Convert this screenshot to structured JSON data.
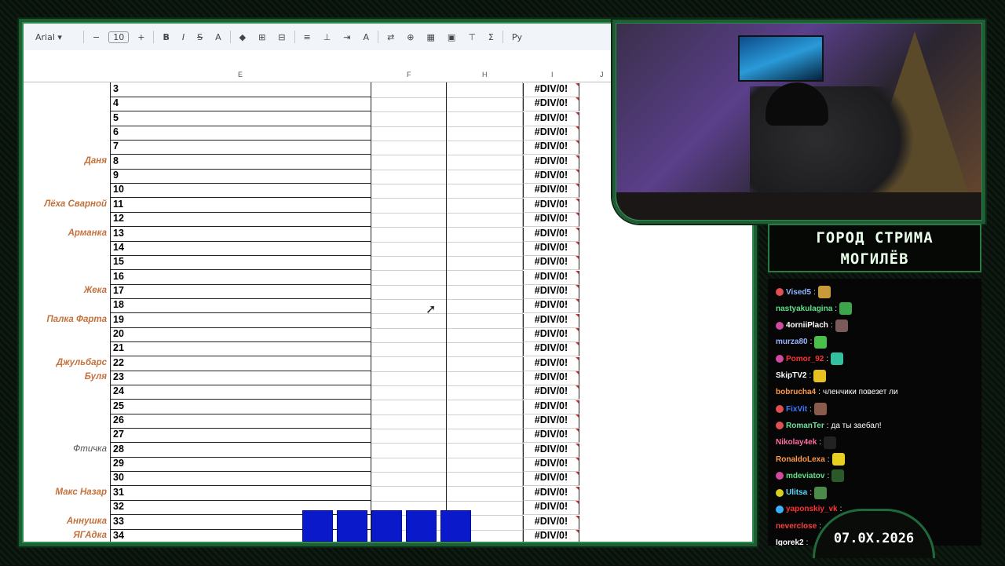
{
  "toolbar": {
    "font": "Arial",
    "font_size": "10",
    "buttons": [
      "−",
      "+",
      "B",
      "I",
      "S",
      "A",
      "◆",
      "⊞",
      "⊟",
      "≡",
      "⊥",
      "⇥",
      "A",
      "⇄",
      "⊕",
      "▦",
      "▣",
      "⊤",
      "Σ",
      "Py"
    ]
  },
  "columns": {
    "e": "E",
    "f": "F",
    "h": "H",
    "i": "I",
    "j": "J"
  },
  "rows": [
    {
      "n": "3",
      "name": "",
      "val": "#DIV/0!"
    },
    {
      "n": "4",
      "name": "",
      "val": "#DIV/0!"
    },
    {
      "n": "5",
      "name": "",
      "val": "#DIV/0!"
    },
    {
      "n": "6",
      "name": "",
      "val": "#DIV/0!"
    },
    {
      "n": "7",
      "name": "",
      "val": "#DIV/0!"
    },
    {
      "n": "8",
      "name": "Даня",
      "val": "#DIV/0!"
    },
    {
      "n": "9",
      "name": "",
      "val": "#DIV/0!"
    },
    {
      "n": "10",
      "name": "",
      "val": "#DIV/0!"
    },
    {
      "n": "11",
      "name": "Лёха Сварной",
      "val": "#DIV/0!"
    },
    {
      "n": "12",
      "name": "",
      "val": "#DIV/0!"
    },
    {
      "n": "13",
      "name": "Арманка",
      "val": "#DIV/0!"
    },
    {
      "n": "14",
      "name": "",
      "val": "#DIV/0!"
    },
    {
      "n": "15",
      "name": "",
      "val": "#DIV/0!"
    },
    {
      "n": "16",
      "name": "",
      "val": "#DIV/0!"
    },
    {
      "n": "17",
      "name": "Жека",
      "val": "#DIV/0!"
    },
    {
      "n": "18",
      "name": "",
      "val": "#DIV/0!"
    },
    {
      "n": "19",
      "name": "Палка Фарта",
      "val": "#DIV/0!"
    },
    {
      "n": "20",
      "name": "",
      "val": "#DIV/0!"
    },
    {
      "n": "21",
      "name": "",
      "val": "#DIV/0!"
    },
    {
      "n": "22",
      "name": "Джульбарс",
      "val": "#DIV/0!"
    },
    {
      "n": "23",
      "name": "Буля",
      "val": "#DIV/0!"
    },
    {
      "n": "24",
      "name": "",
      "val": "#DIV/0!"
    },
    {
      "n": "25",
      "name": "",
      "val": "#DIV/0!"
    },
    {
      "n": "26",
      "name": "",
      "val": "#DIV/0!"
    },
    {
      "n": "27",
      "name": "",
      "val": "#DIV/0!"
    },
    {
      "n": "28",
      "name": "Фтичка",
      "val": "#DIV/0!"
    },
    {
      "n": "29",
      "name": "",
      "val": "#DIV/0!"
    },
    {
      "n": "30",
      "name": "",
      "val": "#DIV/0!"
    },
    {
      "n": "31",
      "name": "Макс Назар",
      "val": "#DIV/0!"
    },
    {
      "n": "32",
      "name": "",
      "val": "#DIV/0!"
    },
    {
      "n": "33",
      "name": "Аннушка",
      "val": "#DIV/0!"
    },
    {
      "n": "34",
      "name": "ЯГАдка",
      "val": "#DIV/0!"
    }
  ],
  "stream_title": [
    "ГОРОД СТРИМА",
    "МОГИЛЁВ"
  ],
  "chat": [
    {
      "user": "Vised5",
      "text": "",
      "color": "#8fb8ff",
      "badge": "#e05050"
    },
    {
      "user": "nastyakulagina",
      "text": "",
      "color": "#5fe08a",
      "badge": ""
    },
    {
      "user": "4orniiPlach",
      "text": "",
      "color": "#ffffff",
      "badge": "#d04aa0"
    },
    {
      "user": "murza80",
      "text": "",
      "color": "#9ab4ff",
      "badge": ""
    },
    {
      "user": "Pomor_92",
      "text": "",
      "color": "#ff3333",
      "badge": "#d04aa0"
    },
    {
      "user": "SkipTV2",
      "text": "",
      "color": "#ffffff",
      "badge": ""
    },
    {
      "user": "bobrucha4",
      "text": "членчики повезет ли",
      "color": "#ff9a4a",
      "badge": ""
    },
    {
      "user": "FixVit",
      "text": "",
      "color": "#3a7bff",
      "badge": "#e05050"
    },
    {
      "user": "RomanTer",
      "text": "да ты заебал!",
      "color": "#6fe09a",
      "badge": "#e05050"
    },
    {
      "user": "Nikolay4ek",
      "text": "",
      "color": "#ff6fa0",
      "badge": ""
    },
    {
      "user": "RonaldoLexa",
      "text": "",
      "color": "#ff9a4a",
      "badge": ""
    },
    {
      "user": "mdeviatov",
      "text": "",
      "color": "#5fe08a",
      "badge": "#d04aa0"
    },
    {
      "user": "Ulitsa",
      "text": "",
      "color": "#5ad8ff",
      "badge": "#d8d020"
    },
    {
      "user": "yaponskiy_vk",
      "text": "",
      "color": "#ff3333",
      "badge": "#3ab0ff"
    },
    {
      "user": "neverclose",
      "text": "",
      "color": "#ff4040",
      "badge": ""
    },
    {
      "user": "Igorek2",
      "text": "",
      "color": "#ffffff",
      "badge": ""
    }
  ],
  "date": "07.0X.2026"
}
